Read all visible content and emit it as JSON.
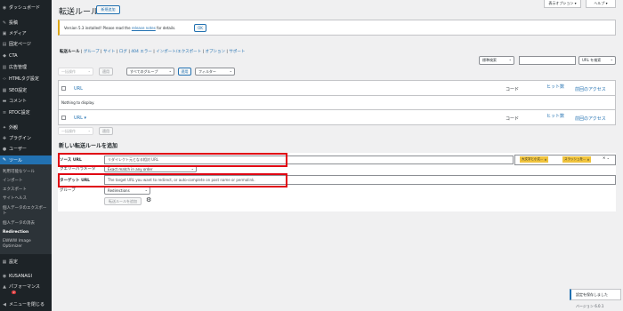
{
  "sidebar": {
    "items": [
      {
        "icon": "dashboard-icon",
        "glyph": "◉",
        "label": "ダッシュボード"
      },
      {
        "icon": "pin-icon",
        "glyph": "✎",
        "label": "投稿"
      },
      {
        "icon": "media-icon",
        "glyph": "▣",
        "label": "メディア"
      },
      {
        "icon": "page-icon",
        "glyph": "▤",
        "label": "固定ページ"
      },
      {
        "icon": "cta-icon",
        "glyph": "◆",
        "label": "CTA"
      },
      {
        "icon": "ad-icon",
        "glyph": "▥",
        "label": "広告管理"
      },
      {
        "icon": "code-icon",
        "glyph": "‹›",
        "label": "HTMLタグ設定"
      },
      {
        "icon": "seo-icon",
        "glyph": "▦",
        "label": "SEO設定"
      },
      {
        "icon": "comment-icon",
        "glyph": "▬",
        "label": "コメント"
      },
      {
        "icon": "rtoc-icon",
        "glyph": "≡",
        "label": "RTOC設定"
      },
      {
        "icon": "appearance-icon",
        "glyph": "✦",
        "label": "外観"
      },
      {
        "icon": "plugin-icon",
        "glyph": "✚",
        "label": "プラグイン"
      },
      {
        "icon": "user-icon",
        "glyph": "●",
        "label": "ユーザー"
      },
      {
        "icon": "tool-icon",
        "glyph": "✎",
        "label": "ツール"
      }
    ],
    "subitems": [
      "利用可能なツール",
      "インポート",
      "エクスポート",
      "サイトヘルス",
      "個人データのエクスポー",
      "ト",
      "個人データの消去",
      "Redirection",
      "EWWW Image",
      "Optimizer"
    ],
    "bottom_items": [
      {
        "icon": "settings-icon",
        "glyph": "▦",
        "label": "設定"
      },
      {
        "icon": "kusanagi-icon",
        "glyph": "◉",
        "label": "KUSANAGI"
      },
      {
        "icon": "performance-icon",
        "glyph": "▲",
        "label": "パフォーマンス"
      },
      {
        "icon": "collapse-icon",
        "glyph": "◀",
        "label": "メニューを閉じる"
      }
    ],
    "badge": "2"
  },
  "header": {
    "title": "転送ルール",
    "add_new": "新規追加",
    "screen_options": "表示オプション ▾",
    "help": "ヘルプ ▾"
  },
  "notice": {
    "text_before": "Version 5.3 installed! Please read the ",
    "link": "release notes",
    "text_after": " for details.",
    "ok": "OK"
  },
  "subnav": {
    "current": "転送ルール",
    "items": [
      "グループ",
      "サイト",
      "ログ",
      "404 エラー",
      "インポート/エクスポート",
      "オプション",
      "サポート"
    ],
    "sep": " | "
  },
  "filters": {
    "standard_search": "標準検索",
    "search_by": "URL を検索",
    "bulk": "一括操作",
    "apply": "適用",
    "all_groups": "すべてのグループ",
    "apply2": "適用",
    "filter": "フィルター"
  },
  "table": {
    "col_url": "URL",
    "col_code": "コード",
    "col_hits": "ヒット数",
    "col_last": "前回のアクセス",
    "empty": "Nothing to display.",
    "foot_url": "URL ▾"
  },
  "bulk_bottom": {
    "bulk": "一括操作",
    "apply": "適用"
  },
  "add_form": {
    "title": "新しい転送ルールを追加",
    "source_label": "ソース URL",
    "source_placeholder": "リダイレクト元となる相対 URL",
    "query_label": "クエリーパラメータ",
    "query_value": "Exact match in any order",
    "target_label": "ターゲット URL",
    "target_placeholder": "The target URL you want to redirect, or auto-complete on post name or permalink.",
    "group_label": "グループ",
    "group_value": "Redirections",
    "submit": "転送ルールを追加",
    "tag1": "大文字と小文...",
    "tag2": "スラッシュを..."
  },
  "footer": {
    "save": "設定を保存しました",
    "version": "バージョン 6.0.1"
  },
  "colors": {
    "accent": "#2271b1",
    "highlight": "#e00012",
    "sidebar": "#1d2327"
  }
}
